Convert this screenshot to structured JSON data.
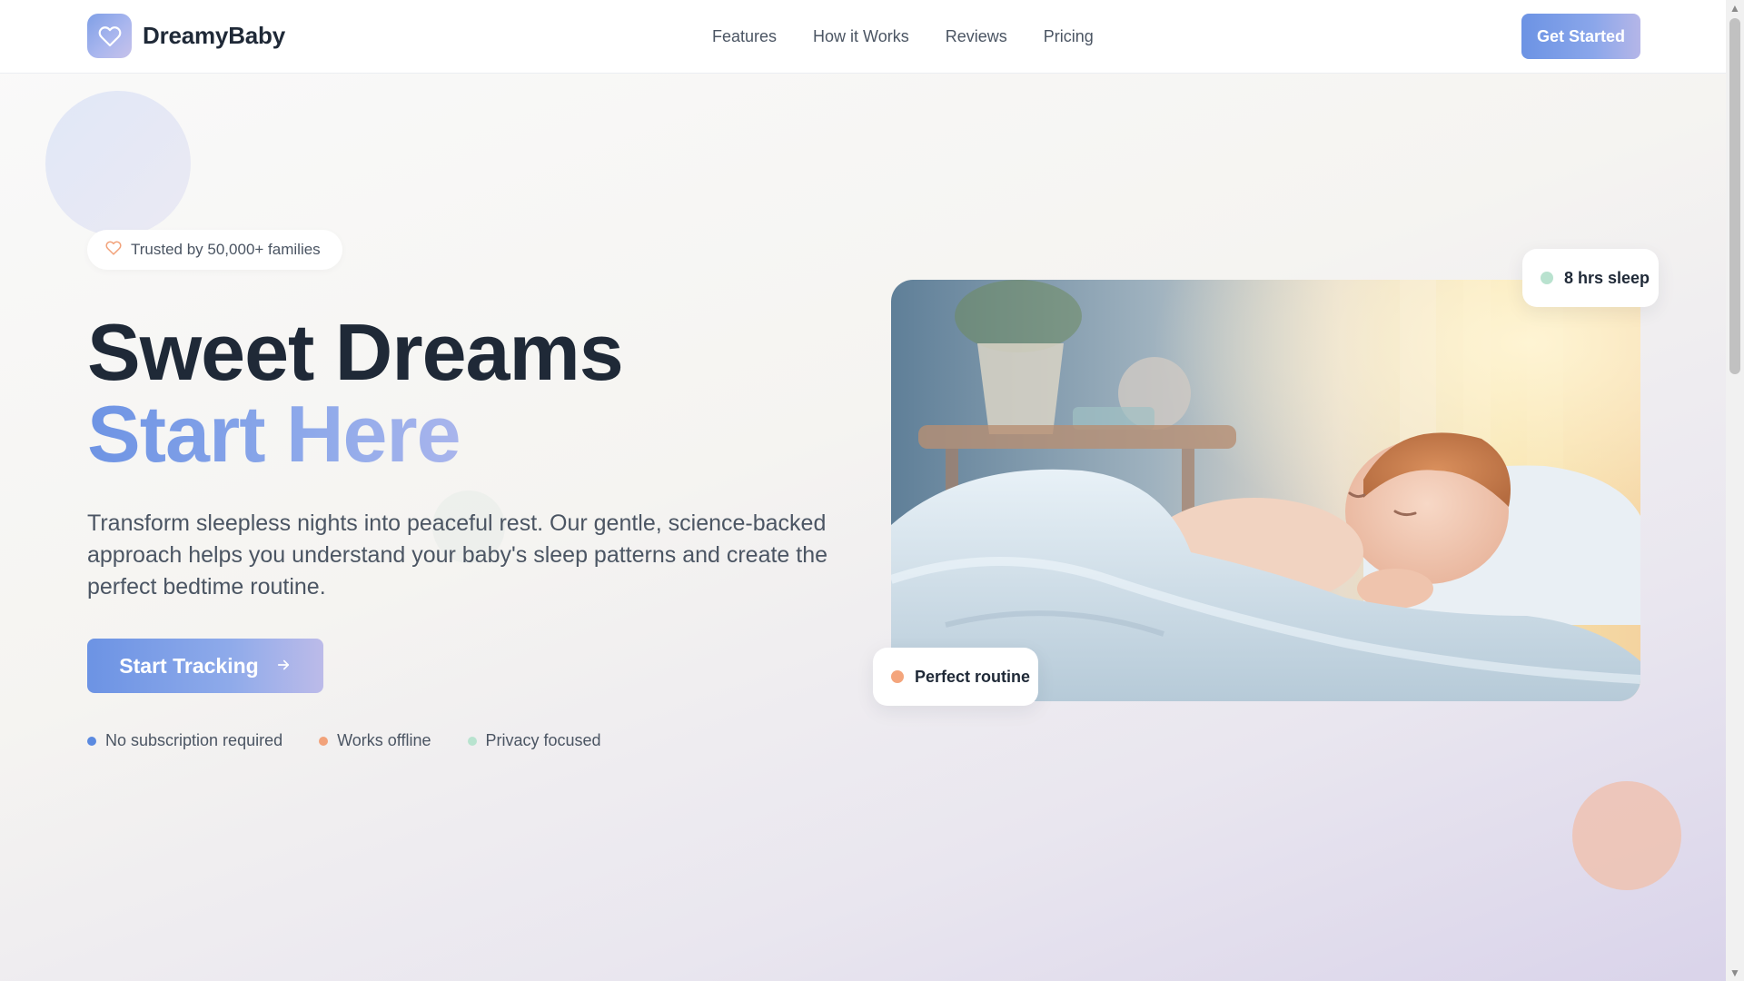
{
  "brand": {
    "name": "DreamyBaby",
    "icon": "heart-icon",
    "accent": "#6c93e4"
  },
  "nav": {
    "links": [
      "Features",
      "How it Works",
      "Reviews",
      "Pricing"
    ],
    "cta": "Get Started"
  },
  "hero": {
    "badge": "Trusted by 50,000+ families",
    "title_line1": "Sweet Dreams",
    "title_line2": "Start Here",
    "description": "Transform sleepless nights into peaceful rest. Our gentle, science-backed approach helps you understand your baby's sleep patterns and create the perfect bedtime routine.",
    "cta": "Start Tracking",
    "cta_icon": "arrow-right-icon",
    "features": [
      {
        "label": "No subscription required",
        "color": "#5b8ae0"
      },
      {
        "label": "Works offline",
        "color": "#f2a27a"
      },
      {
        "label": "Privacy focused",
        "color": "#b8e3cf"
      }
    ]
  },
  "image_cards": {
    "sleep": {
      "label": "8 hrs sleep",
      "color": "#b9e2cf"
    },
    "routine": {
      "label": "Perfect routine",
      "color": "#f4a57c"
    }
  }
}
